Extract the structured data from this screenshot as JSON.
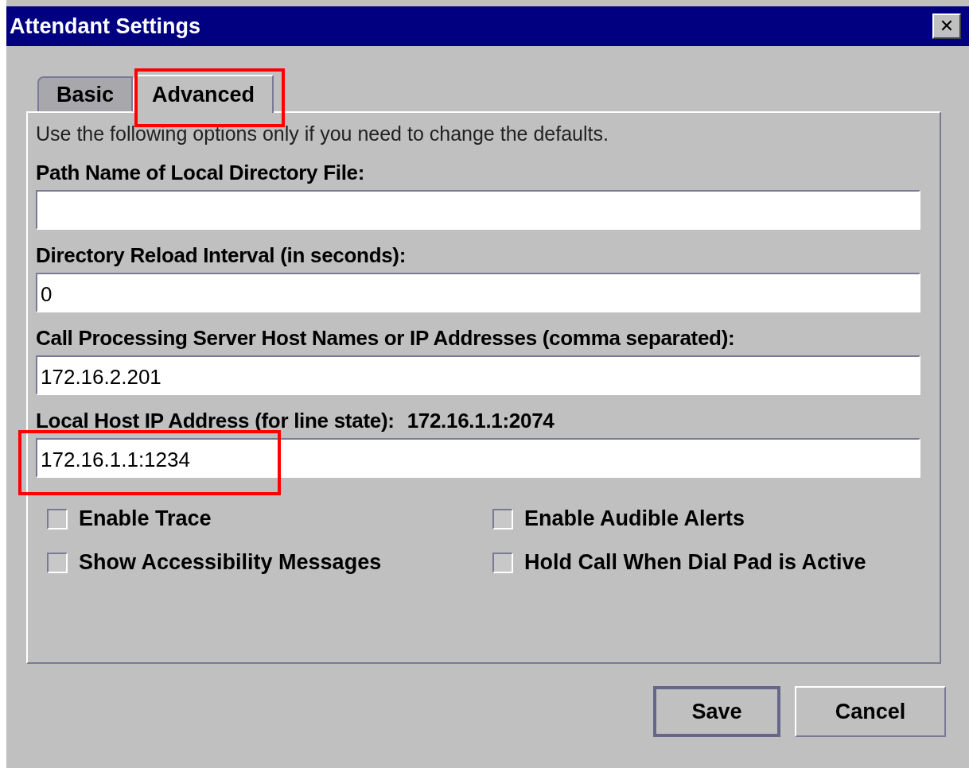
{
  "window": {
    "title": "Attendant Settings",
    "close": "✕"
  },
  "tabs": [
    {
      "label": "Basic",
      "selected": false,
      "highlighted": false
    },
    {
      "label": "Advanced",
      "selected": true,
      "highlighted": true
    }
  ],
  "intro": "Use the following options only if you need to change the defaults.",
  "fields": [
    {
      "label": "Path Name of Local Directory File:",
      "highlighted": false
    },
    {
      "label": "Directory Reload Interval (in seconds):",
      "value": "0",
      "highlighted": false
    },
    {
      "label": "Call Processing Server Host Names or IP Addresses (comma separated):",
      "value": "172.16.2.201",
      "highlighted": false
    },
    {
      "label": "Local Host IP Address (for line state):",
      "info": "172.16.1.1:2074",
      "value": "172.16.1.1:1234",
      "highlighted": true
    }
  ],
  "checkboxes": [
    {
      "label": "Enable Trace",
      "checked": false
    },
    {
      "label": "Enable Audible Alerts",
      "checked": false
    },
    {
      "label": "Show Accessibility Messages",
      "checked": false
    },
    {
      "label": "Hold Call When Dial Pad is Active",
      "checked": false
    }
  ],
  "buttons": [
    {
      "label": "Save",
      "default": true
    },
    {
      "label": "Cancel",
      "default": false
    }
  ]
}
